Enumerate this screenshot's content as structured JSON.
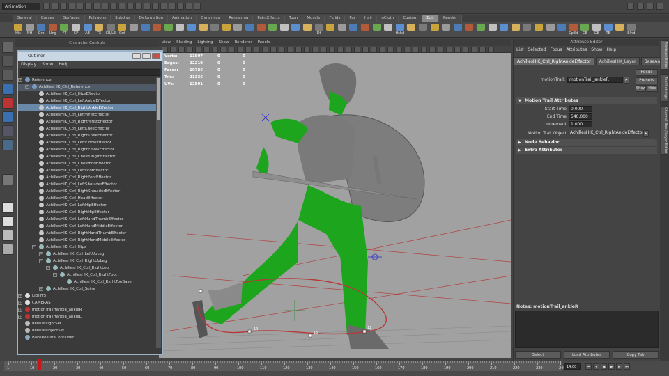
{
  "topbar": {
    "mode": "Animation"
  },
  "shelf_tabs": [
    {
      "label": "General"
    },
    {
      "label": "Curves"
    },
    {
      "label": "Surfaces"
    },
    {
      "label": "Polygons"
    },
    {
      "label": "Subdivs"
    },
    {
      "label": "Deformation"
    },
    {
      "label": "Animation"
    },
    {
      "label": "Dynamics"
    },
    {
      "label": "Rendering"
    },
    {
      "label": "PaintEffects"
    },
    {
      "label": "Toon"
    },
    {
      "label": "Muscle"
    },
    {
      "label": "Fluids"
    },
    {
      "label": "Fur"
    },
    {
      "label": "Hair"
    },
    {
      "label": "nCloth"
    },
    {
      "label": "Custom"
    },
    {
      "label": "Edit"
    },
    {
      "label": "Render"
    }
  ],
  "shelf_active": "Edit",
  "shelf_icons": [
    "His",
    "NH",
    "Gro",
    "Ung",
    "FT",
    "CP",
    "AE",
    "TS",
    "CB/LE",
    "Out",
    "",
    "",
    "",
    "",
    "",
    "",
    "",
    "",
    "",
    "",
    "",
    "",
    "",
    "",
    "",
    "",
    "Df",
    "",
    "",
    "",
    "",
    "",
    "",
    "Hshd",
    "",
    "",
    "",
    "",
    "",
    "",
    "",
    "",
    "",
    "",
    "",
    "",
    "",
    "",
    "CpEd",
    "CE",
    "GE",
    "TE",
    "",
    "Blnd"
  ],
  "charctl_title": "Character Controls",
  "outliner": {
    "title": "Outliner",
    "menu": [
      "Display",
      "Show",
      "Help"
    ],
    "rows": [
      {
        "label": "Reference",
        "indent": 0,
        "icon": "reference",
        "expand": "+"
      },
      {
        "label": "AchillesHIK_Ctrl_Reference",
        "indent": 1,
        "icon": "reference",
        "expand": "-",
        "selected": false,
        "highlight": true
      },
      {
        "label": "AchillesHIK_Ctrl_HipsEffector",
        "indent": 2,
        "icon": "effector"
      },
      {
        "label": "AchillesHIK_Ctrl_LeftAnkleEffector",
        "indent": 2,
        "icon": "effector"
      },
      {
        "label": "AchillesHIK_Ctrl_RightAnkleEffector",
        "indent": 2,
        "icon": "effector",
        "selected": true
      },
      {
        "label": "AchillesHIK_Ctrl_LeftWristEffector",
        "indent": 2,
        "icon": "effector"
      },
      {
        "label": "AchillesHIK_Ctrl_RightWristEffector",
        "indent": 2,
        "icon": "effector"
      },
      {
        "label": "AchillesHIK_Ctrl_LeftKneeEffector",
        "indent": 2,
        "icon": "effector"
      },
      {
        "label": "AchillesHIK_Ctrl_RightKneeEffector",
        "indent": 2,
        "icon": "effector"
      },
      {
        "label": "AchillesHIK_Ctrl_LeftElbowEffector",
        "indent": 2,
        "icon": "effector"
      },
      {
        "label": "AchillesHIK_Ctrl_RightElbowEffector",
        "indent": 2,
        "icon": "effector"
      },
      {
        "label": "AchillesHIK_Ctrl_ChestOriginEffector",
        "indent": 2,
        "icon": "effector"
      },
      {
        "label": "AchillesHIK_Ctrl_ChestEndEffector",
        "indent": 2,
        "icon": "effector"
      },
      {
        "label": "AchillesHIK_Ctrl_LeftFootEffector",
        "indent": 2,
        "icon": "effector"
      },
      {
        "label": "AchillesHIK_Ctrl_RightFootEffector",
        "indent": 2,
        "icon": "effector"
      },
      {
        "label": "AchillesHIK_Ctrl_LeftShoulderEffector",
        "indent": 2,
        "icon": "effector"
      },
      {
        "label": "AchillesHIK_Ctrl_RightShoulderEffector",
        "indent": 2,
        "icon": "effector"
      },
      {
        "label": "AchillesHIK_Ctrl_HeadEffector",
        "indent": 2,
        "icon": "effector"
      },
      {
        "label": "AchillesHIK_Ctrl_LeftHipEffector",
        "indent": 2,
        "icon": "effector"
      },
      {
        "label": "AchillesHIK_Ctrl_RightHipEffector",
        "indent": 2,
        "icon": "effector"
      },
      {
        "label": "AchillesHIK_Ctrl_LeftHandThumbEffector",
        "indent": 2,
        "icon": "effector"
      },
      {
        "label": "AchillesHIK_Ctrl_LeftHandMiddleEffector",
        "indent": 2,
        "icon": "effector"
      },
      {
        "label": "AchillesHIK_Ctrl_RightHandThumbEffector",
        "indent": 2,
        "icon": "effector"
      },
      {
        "label": "AchillesHIK_Ctrl_RightHandMiddleEffector",
        "indent": 2,
        "icon": "effector"
      },
      {
        "label": "AchillesHIK_Ctrl_Hips",
        "indent": 2,
        "icon": "joint",
        "expand": "-"
      },
      {
        "label": "AchillesHIK_Ctrl_LeftUpLeg",
        "indent": 3,
        "icon": "joint",
        "expand": "+"
      },
      {
        "label": "AchillesHIK_Ctrl_RightUpLeg",
        "indent": 3,
        "icon": "joint",
        "expand": "-"
      },
      {
        "label": "AchillesHIK_Ctrl_RightLeg",
        "indent": 4,
        "icon": "joint",
        "expand": "-"
      },
      {
        "label": "AchillesHIK_Ctrl_RightFoot",
        "indent": 5,
        "icon": "joint",
        "expand": "-"
      },
      {
        "label": "AchillesHIK_Ctrl_RightToeBase",
        "indent": 6,
        "icon": "joint"
      },
      {
        "label": "AchillesHIK_Ctrl_Spine",
        "indent": 3,
        "icon": "joint",
        "expand": "+"
      },
      {
        "label": "LIGHTS",
        "indent": 0,
        "icon": "layer",
        "expand": "+"
      },
      {
        "label": "CAMERAS",
        "indent": 0,
        "icon": "layer",
        "expand": "+"
      },
      {
        "label": "motionTrailHandle_ankleR",
        "indent": 0,
        "icon": "trail",
        "expand": "+"
      },
      {
        "label": "motionTrailHandle_ankleL",
        "indent": 0,
        "icon": "trail",
        "expand": "+"
      },
      {
        "label": "defaultLightSet",
        "indent": 0,
        "icon": "set"
      },
      {
        "label": "defaultObjectSet",
        "indent": 0,
        "icon": "set"
      },
      {
        "label": "BakeResultsContainer",
        "indent": 0,
        "icon": "container"
      }
    ]
  },
  "viewport": {
    "menu": [
      "View",
      "Shading",
      "Lighting",
      "Show",
      "Renderer",
      "Panels"
    ],
    "hud": [
      {
        "k": "Verts:",
        "v": "11507",
        "a": "0",
        "b": "0"
      },
      {
        "k": "Edges:",
        "v": "22219",
        "a": "0",
        "b": "0"
      },
      {
        "k": "Faces:",
        "v": "10786",
        "a": "0",
        "b": "0"
      },
      {
        "k": "Tris:",
        "v": "21336",
        "a": "0",
        "b": "0"
      },
      {
        "k": "UVs:",
        "v": "12591",
        "a": "0",
        "b": "0"
      }
    ],
    "trail_frames": [
      "19",
      "16",
      "12"
    ]
  },
  "attribute_editor": {
    "title": "Attribute Editor",
    "menu": [
      "List",
      "Selected",
      "Focus",
      "Attributes",
      "Show",
      "Help"
    ],
    "node_tabs": [
      "AchillesHIK_Ctrl_RightAnkleEffector",
      "AchillesHIK_Layer",
      "BaseAnimation"
    ],
    "node_label": "motionTrail:",
    "node_name": "motionTrail_ankleR",
    "focus_btn": "Focus",
    "presets_btn": "Presets",
    "show_btn": "Show",
    "hide_btn": "Hide",
    "sections": {
      "motion_trail": "Motion Trail Attributes",
      "node_behavior": "Node Behavior",
      "extra": "Extra Attributes"
    },
    "fields": [
      {
        "label": "Start Time",
        "value": "0.000"
      },
      {
        "label": "End Time",
        "value": "540.000"
      },
      {
        "label": "Increment",
        "value": "1.000"
      }
    ],
    "trail_obj_label": "Motion Trail Object",
    "trail_obj_value": "AchillesHIK_Ctrl_RightAnkleEffector",
    "notes_label": "Notes: motionTrail_ankleR",
    "buttons": [
      "Select",
      "Load Attributes",
      "Copy Tab"
    ]
  },
  "right_tabs": [
    "Attribute Editor",
    "Tool Settings",
    "Channel Box / Layer Editor"
  ],
  "timeline": {
    "ticks": [
      "1",
      "10",
      "20",
      "30",
      "40",
      "50",
      "60",
      "70",
      "80",
      "90",
      "100",
      "110",
      "120",
      "130",
      "140",
      "150",
      "160",
      "170",
      "180",
      "190",
      "200",
      "210",
      "220",
      "230",
      "240"
    ],
    "current": "14.00"
  },
  "colors": {
    "accent": "#6a88a8",
    "body_green": "#1ea51e",
    "trail_red": "#b53a3a",
    "viewport_bg": "#a1a1a1"
  }
}
